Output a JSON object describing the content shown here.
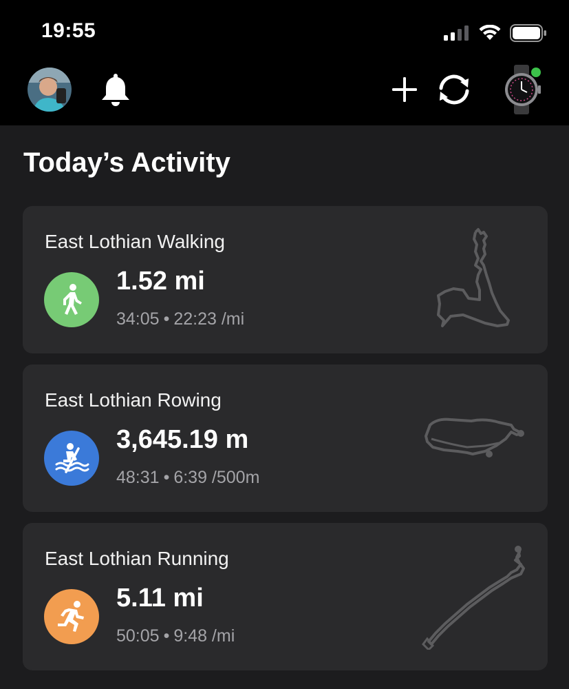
{
  "status": {
    "time": "19:55"
  },
  "header": {
    "icons": [
      "avatar",
      "bell-icon",
      "plus-icon",
      "sync-icon",
      "watch-icon"
    ],
    "watch_status_color": "#3cc24a"
  },
  "section": {
    "title": "Today’s Activity"
  },
  "activities": [
    {
      "title": "East Lothian Walking",
      "metric": "1.52 mi",
      "duration": "34:05",
      "separator": "•",
      "pace": "22:23 /mi",
      "icon": "walking-icon",
      "color": "#77cb75"
    },
    {
      "title": "East Lothian Rowing",
      "metric": "3,645.19 m",
      "duration": "48:31",
      "separator": "•",
      "pace": "6:39 /500m",
      "icon": "rowing-icon",
      "color": "#3b7ad9"
    },
    {
      "title": "East Lothian Running",
      "metric": "5.11 mi",
      "duration": "50:05",
      "separator": "•",
      "pace": "9:48 /mi",
      "icon": "running-icon",
      "color": "#f29d50"
    }
  ]
}
